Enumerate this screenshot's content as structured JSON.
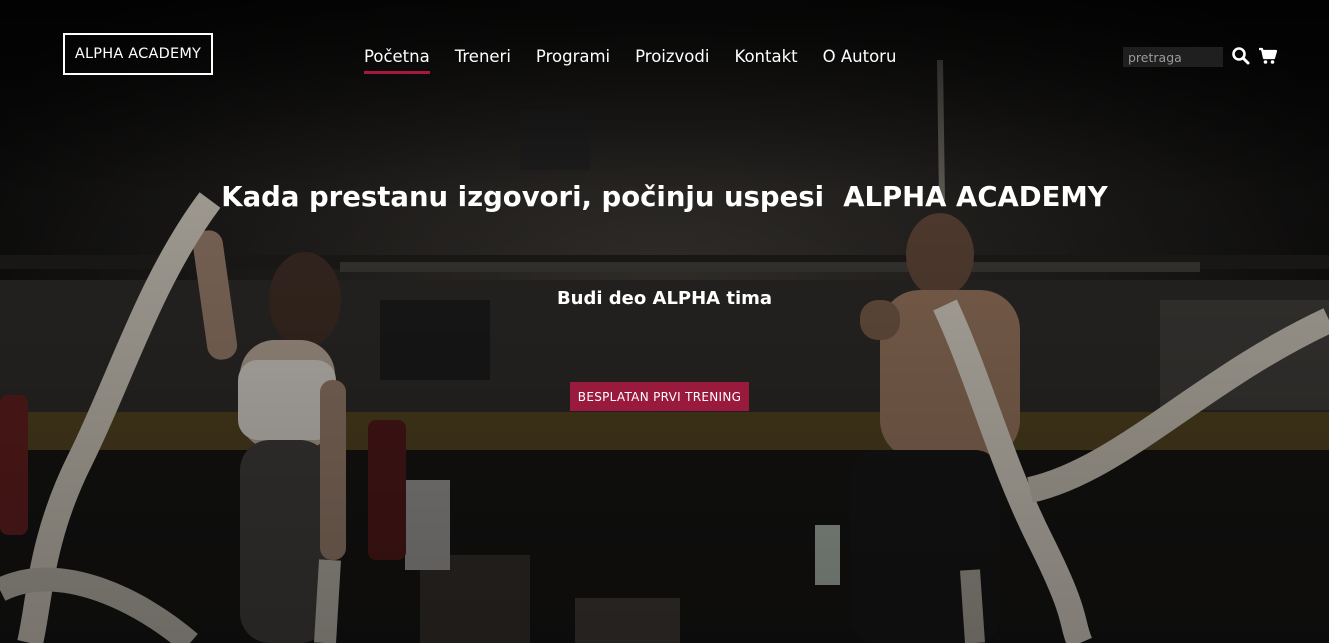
{
  "brand": {
    "logo_text": "ALPHA ACADEMY"
  },
  "nav": {
    "items": [
      {
        "label": "Početna",
        "active": true
      },
      {
        "label": "Treneri"
      },
      {
        "label": "Programi"
      },
      {
        "label": "Proizvodi"
      },
      {
        "label": "Kontakt"
      },
      {
        "label": "O Autoru"
      }
    ]
  },
  "search": {
    "placeholder": "pretraga",
    "value": ""
  },
  "icons": {
    "search": "search-icon",
    "cart": "cart-icon"
  },
  "hero": {
    "headline": "Kada prestanu izgovori, počinju uspesi  ALPHA ACADEMY",
    "subheadline": "Budi deo ALPHA tima",
    "cta_label": "BESPLATAN PRVI TRENING",
    "background": "gym-battle-ropes-photo"
  },
  "colors": {
    "accent": "#9a1a3d",
    "text": "#ffffff",
    "background": "#0b0b0b"
  }
}
